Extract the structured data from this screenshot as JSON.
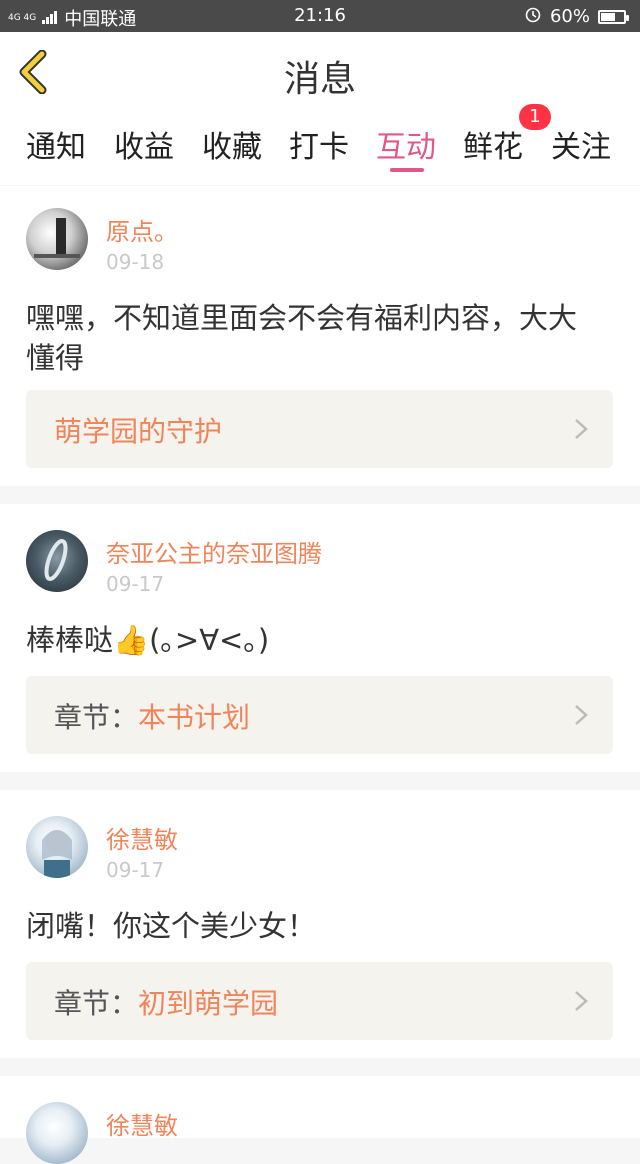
{
  "status": {
    "carrier_net": "4G 4G",
    "carrier": "中国联通",
    "time": "21:16",
    "battery": "60%",
    "battery_level": 0.6
  },
  "header": {
    "title": "消息"
  },
  "tabs": [
    {
      "label": "通知",
      "active": false
    },
    {
      "label": "收益",
      "active": false
    },
    {
      "label": "收藏",
      "active": false
    },
    {
      "label": "打卡",
      "active": false
    },
    {
      "label": "互动",
      "active": true
    },
    {
      "label": "鲜花",
      "active": false,
      "badge": "1"
    },
    {
      "label": "关注",
      "active": false
    }
  ],
  "messages": [
    {
      "user": "原点。",
      "date": "09-18",
      "content": "嘿嘿，不知道里面会不会有福利内容，大大懂得",
      "ref_prefix": "",
      "ref_title": "萌学园的守护"
    },
    {
      "user": "奈亚公主的奈亚图腾",
      "date": "09-17",
      "content": "棒棒哒👍(｡>∀<｡)",
      "ref_prefix": "章节：",
      "ref_title": "本书计划"
    },
    {
      "user": "徐慧敏",
      "date": "09-17",
      "content": "闭嘴！你这个美少女！",
      "ref_prefix": "章节：",
      "ref_title": "初到萌学园"
    },
    {
      "user": "徐慧敏"
    }
  ],
  "colors": {
    "accent": "#e0578c",
    "username": "#f0845a",
    "badge": "#ff3344",
    "back_arrow": "#f2d03b"
  }
}
